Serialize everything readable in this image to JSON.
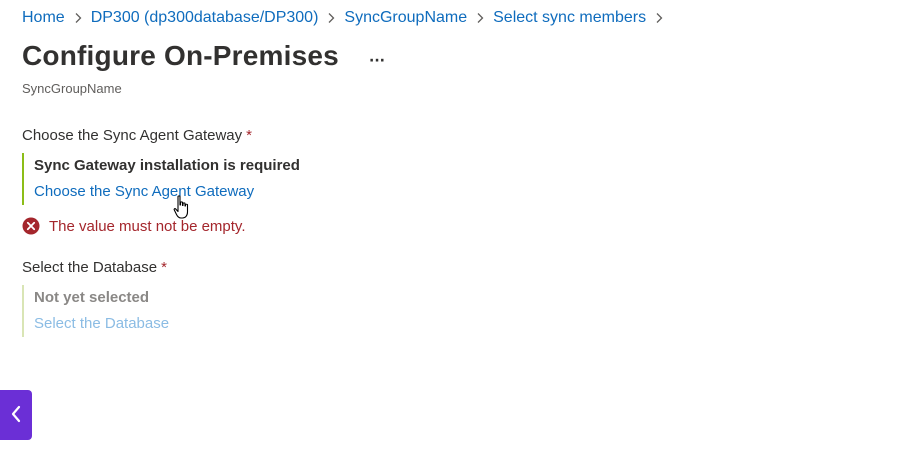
{
  "breadcrumb": [
    {
      "label": "Home"
    },
    {
      "label": "DP300 (dp300database/DP300)"
    },
    {
      "label": "SyncGroupName"
    },
    {
      "label": "Select sync members"
    }
  ],
  "page": {
    "title": "Configure On-Premises",
    "more_label": "···",
    "subtitle": "SyncGroupName"
  },
  "gateway": {
    "label": "Choose the Sync Agent Gateway",
    "required_mark": "*",
    "status": "Sync Gateway installation is required",
    "link": "Choose the Sync Agent Gateway",
    "error": "The value must not be empty."
  },
  "database": {
    "label": "Select the Database",
    "required_mark": "*",
    "status": "Not yet selected",
    "link": "Select the Database"
  },
  "icons": {
    "breadcrumb_separator": "chevron-right-icon",
    "error": "error-circle-icon",
    "collapse": "chevron-left-icon",
    "cursor": "hand-pointer-icon"
  },
  "colors": {
    "link": "#0f6cbd",
    "error": "#a4262c",
    "active_border": "#8cbd18",
    "collapse_button": "#6b2fd6"
  }
}
